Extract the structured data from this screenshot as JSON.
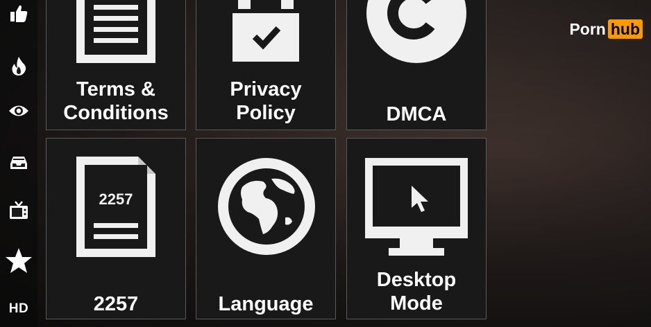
{
  "brand": {
    "porn": "Porn",
    "hub": "hub",
    "accent": "#ff9900"
  },
  "sidebar": {
    "items": [
      {
        "icon": "thumbs-up-icon"
      },
      {
        "icon": "flame-icon"
      },
      {
        "icon": "eye-icon"
      },
      {
        "icon": "inbox-tray-icon"
      },
      {
        "icon": "tv-icon"
      },
      {
        "icon": "star-icon"
      },
      {
        "label": "HD"
      }
    ]
  },
  "tiles": [
    {
      "id": "terms",
      "icon": "document-lines-icon",
      "line1": "Terms &",
      "line2": "Conditions"
    },
    {
      "id": "privacy",
      "icon": "calendar-check-icon",
      "line1": "Privacy",
      "line2": "Policy"
    },
    {
      "id": "dmca",
      "icon": "copyright-icon",
      "line1": "DMCA"
    },
    {
      "id": "2257",
      "icon": "document-2257-icon",
      "doc_text": "2257",
      "line1": "2257"
    },
    {
      "id": "language",
      "icon": "globe-icon",
      "line1": "Language"
    },
    {
      "id": "desktop",
      "icon": "monitor-cursor-icon",
      "line1": "Desktop",
      "line2": "Mode"
    }
  ]
}
